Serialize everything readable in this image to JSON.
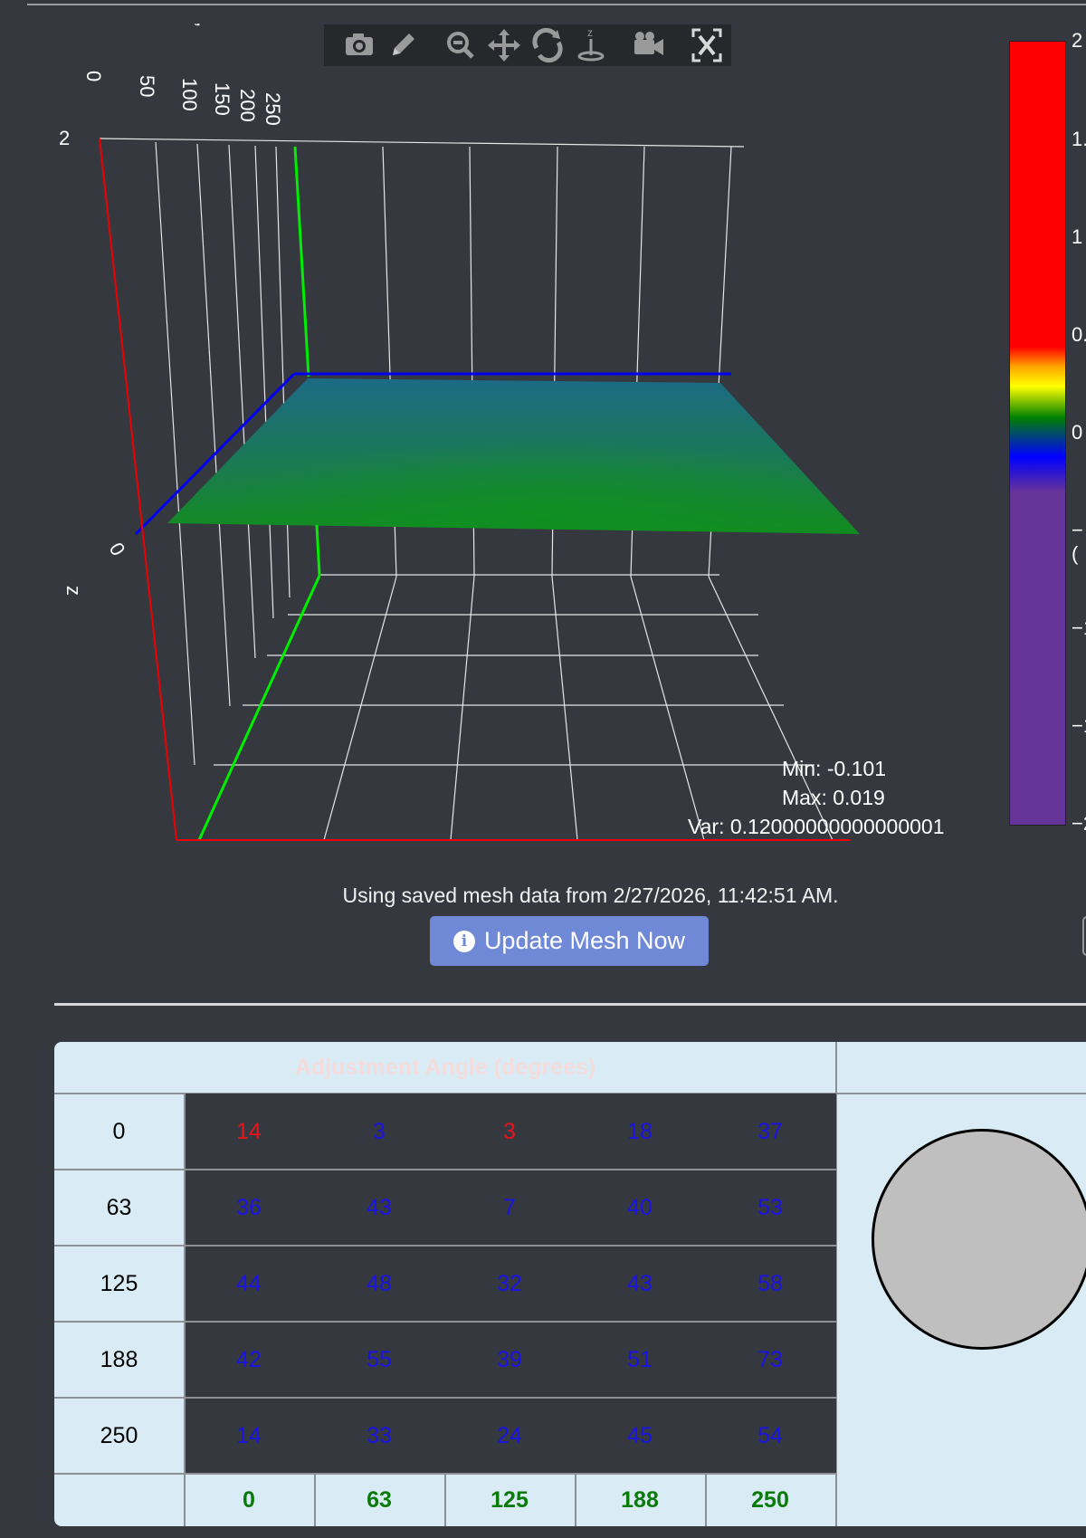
{
  "plot": {
    "toolbar_icons": [
      "camera-icon",
      "pencil-icon",
      "zoom-icon",
      "pan-icon",
      "orbit-icon",
      "turntable-icon",
      "reset-camera-icon",
      "autoscale-icon"
    ],
    "y_axis_ticks": [
      "0",
      "50",
      "100",
      "150",
      "200",
      "250"
    ],
    "y_axis_title": ",",
    "z_axis_title": "z",
    "z_tick_top": "2",
    "z_tick_mid": "0",
    "stats": {
      "min": "Min: -0.101",
      "max": "Max: 0.019",
      "var": "Var: 0.12000000000000001"
    }
  },
  "colorbar": {
    "labels": [
      "2",
      "1.",
      "1",
      "0.",
      "0",
      "−(",
      "−1",
      "−1",
      "−2"
    ],
    "colors": [
      "#ff0000",
      "#ffa500",
      "#ffff00",
      "#008000",
      "#0000ff",
      "#663399"
    ]
  },
  "mesh": {
    "info": "Using saved mesh data from 2/27/2026, 11:42:51 AM.",
    "update_button": "Update Mesh Now"
  },
  "table": {
    "title": "Adjustment Angle (degrees)",
    "row_labels": [
      "0",
      "63",
      "125",
      "188",
      "250"
    ],
    "col_labels": [
      "0",
      "63",
      "125",
      "188",
      "250"
    ],
    "rows": [
      [
        {
          "v": "14",
          "c": "red"
        },
        {
          "v": "3",
          "c": "blue"
        },
        {
          "v": "3",
          "c": "red"
        },
        {
          "v": "18",
          "c": "blue"
        },
        {
          "v": "37",
          "c": "blue"
        }
      ],
      [
        {
          "v": "36",
          "c": "blue"
        },
        {
          "v": "43",
          "c": "blue"
        },
        {
          "v": "7",
          "c": "blue"
        },
        {
          "v": "40",
          "c": "blue"
        },
        {
          "v": "53",
          "c": "blue"
        }
      ],
      [
        {
          "v": "44",
          "c": "blue"
        },
        {
          "v": "48",
          "c": "blue"
        },
        {
          "v": "32",
          "c": "blue"
        },
        {
          "v": "43",
          "c": "blue"
        },
        {
          "v": "58",
          "c": "blue"
        }
      ],
      [
        {
          "v": "42",
          "c": "blue"
        },
        {
          "v": "55",
          "c": "blue"
        },
        {
          "v": "39",
          "c": "blue"
        },
        {
          "v": "51",
          "c": "blue"
        },
        {
          "v": "73",
          "c": "blue"
        }
      ],
      [
        {
          "v": "14",
          "c": "blue"
        },
        {
          "v": "33",
          "c": "blue"
        },
        {
          "v": "24",
          "c": "blue"
        },
        {
          "v": "45",
          "c": "blue"
        },
        {
          "v": "54",
          "c": "blue"
        }
      ]
    ]
  }
}
